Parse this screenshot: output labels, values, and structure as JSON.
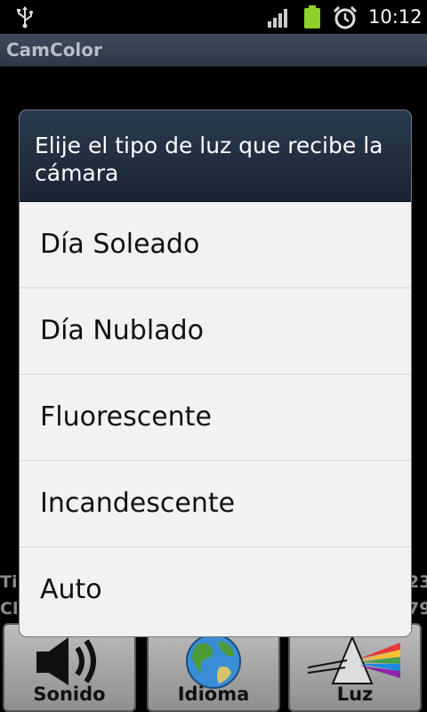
{
  "status_bar": {
    "time": "10:12",
    "icons": [
      "usb-icon",
      "signal-icon",
      "battery-icon",
      "alarm-icon"
    ]
  },
  "app": {
    "title": "CamColor"
  },
  "background": {
    "left_fragment_1": "Ti",
    "left_fragment_2": "Cl",
    "right_fragment_1": "23",
    "right_fragment_2": "79"
  },
  "bottom_buttons": [
    {
      "label": "Sonido",
      "icon": "speaker-icon"
    },
    {
      "label": "Idioma",
      "icon": "globe-icon"
    },
    {
      "label": "Luz",
      "icon": "prism-icon"
    }
  ],
  "dialog": {
    "title": "Elije el tipo de luz que recibe la cámara",
    "options": [
      {
        "label": "Día Soleado"
      },
      {
        "label": "Día Nublado"
      },
      {
        "label": "Fluorescente"
      },
      {
        "label": "Incandescente"
      },
      {
        "label": "Auto"
      }
    ]
  }
}
